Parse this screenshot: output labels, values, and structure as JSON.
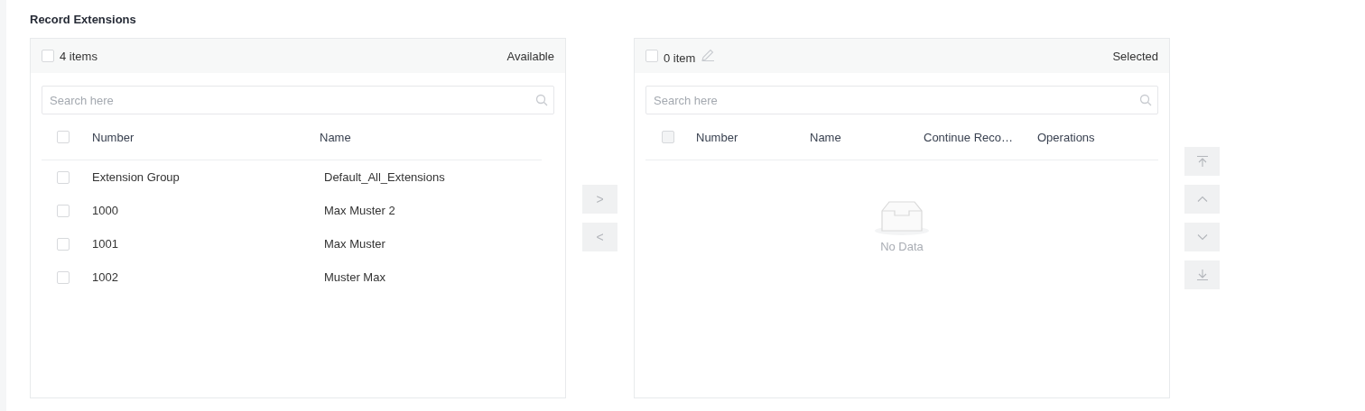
{
  "title": "Record Extensions",
  "available": {
    "count": "4 items",
    "label": "Available",
    "checked": false,
    "search": {
      "placeholder": "Search here"
    },
    "columns": [
      "Number",
      "Name"
    ],
    "header_checked": false,
    "rows": [
      {
        "number": "Extension Group",
        "name": "Default_All_Extensions",
        "checked": false
      },
      {
        "number": "1000",
        "name": "Max Muster 2",
        "checked": false
      },
      {
        "number": "1001",
        "name": "Max Muster",
        "checked": false
      },
      {
        "number": "1002",
        "name": "Muster Max",
        "checked": false
      }
    ]
  },
  "transfer_buttons": [
    {
      "label": ">",
      "disabled": true
    },
    {
      "label": "<",
      "disabled": true
    }
  ],
  "selected": {
    "count": "0 item",
    "label": "Selected",
    "checked": false,
    "disabled": true,
    "search": {
      "placeholder": "Search here"
    },
    "columns": [
      "Number",
      "Name",
      "Continue Reco…",
      "Operations"
    ],
    "header_checked": false,
    "empty_text": "No Data"
  },
  "order_buttons": [
    {
      "kind": "top",
      "disabled": true
    },
    {
      "kind": "up",
      "disabled": true
    },
    {
      "kind": "down",
      "disabled": true
    },
    {
      "kind": "bottom",
      "disabled": true
    }
  ]
}
